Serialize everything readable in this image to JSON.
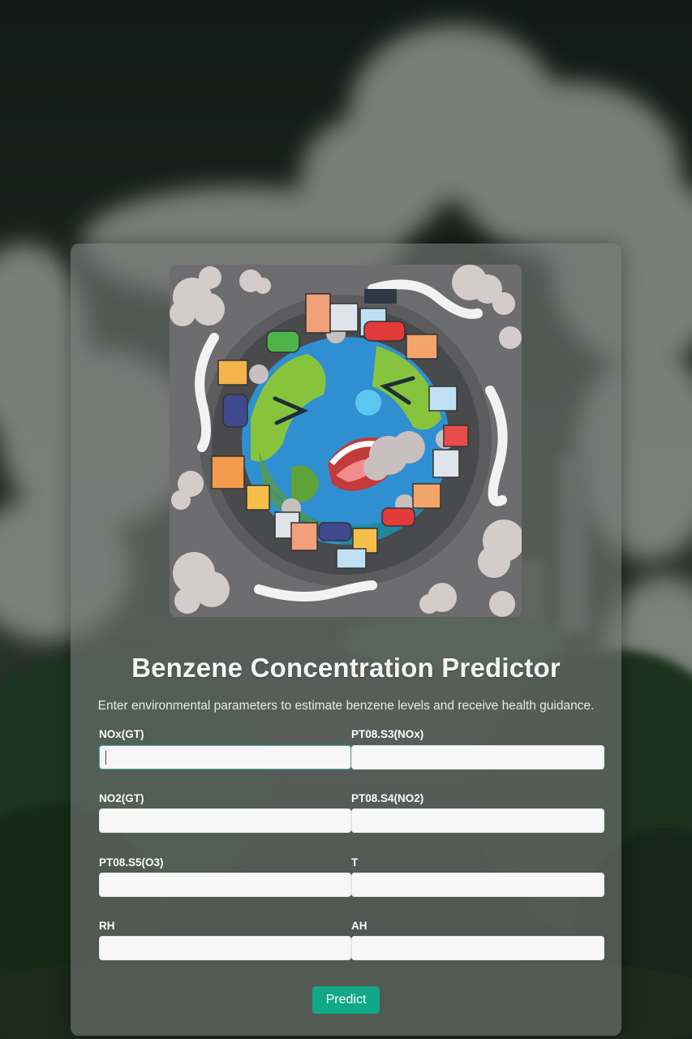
{
  "page": {
    "title": "Benzene Concentration Predictor",
    "subtitle": "Enter environmental parameters to estimate benzene levels and receive health guidance."
  },
  "form": {
    "fields": [
      {
        "label": "NOx(GT)",
        "value": ""
      },
      {
        "label": "PT08.S3(NOx)",
        "value": ""
      },
      {
        "label": "NO2(GT)",
        "value": ""
      },
      {
        "label": "PT08.S4(NO2)",
        "value": ""
      },
      {
        "label": "PT08.S5(O3)",
        "value": ""
      },
      {
        "label": "T",
        "value": ""
      },
      {
        "label": "RH",
        "value": ""
      },
      {
        "label": "AH",
        "value": ""
      }
    ],
    "submit_label": "Predict"
  },
  "illustration": {
    "icon": "polluted-earth-icon"
  },
  "colors": {
    "accent": "#10a886",
    "card": "#767876",
    "field_bg": "#f7f7f7"
  }
}
